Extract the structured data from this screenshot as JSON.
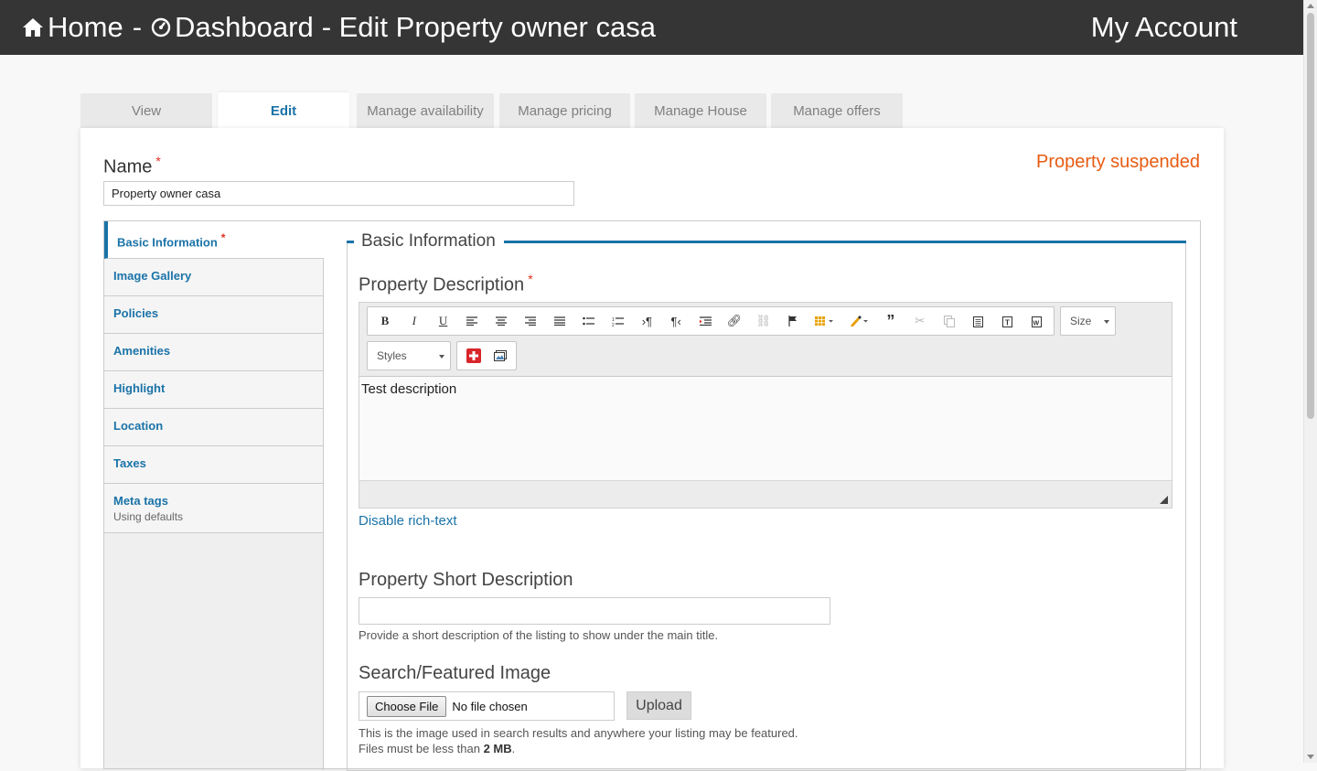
{
  "header": {
    "home_label": "Home",
    "separator": "-",
    "dashboard_label": "Dashboard",
    "page_label": "- Edit Property owner casa",
    "account_label": "My Account"
  },
  "tabs": [
    {
      "label": "View"
    },
    {
      "label": "Edit"
    },
    {
      "label": "Manage availability"
    },
    {
      "label": "Manage pricing"
    },
    {
      "label": "Manage House"
    },
    {
      "label": "Manage offers"
    }
  ],
  "form": {
    "name_label": "Name",
    "required_mark": "*",
    "name_value": "Property owner casa",
    "status": "Property suspended"
  },
  "vertical_tabs": [
    {
      "label": "Basic Information",
      "required": "*"
    },
    {
      "label": "Image Gallery"
    },
    {
      "label": "Policies"
    },
    {
      "label": "Amenities"
    },
    {
      "label": "Highlight"
    },
    {
      "label": "Location"
    },
    {
      "label": "Taxes"
    },
    {
      "label": "Meta tags",
      "sub": "Using defaults"
    }
  ],
  "basic_info": {
    "legend": "Basic Information",
    "description_label": "Property Description",
    "description_value": "Test description",
    "size_combo": "Size",
    "styles_combo": "Styles",
    "disable_rich_text": "Disable rich-text",
    "short_desc_label": "Property Short Description",
    "short_desc_value": "",
    "short_desc_help": "Provide a short description of the listing to show under the main title.",
    "image_label": "Search/Featured Image",
    "choose_file": "Choose File",
    "no_file": "No file chosen",
    "upload": "Upload",
    "image_help_1": "This is the image used in search results and anywhere your listing may be featured.",
    "image_help_2_prefix": "Files must be less than ",
    "image_help_2_bold": "2 MB",
    "image_help_2_suffix": "."
  },
  "colors": {
    "header_bg": "#353535",
    "accent": "#1a73a8",
    "status": "#e85b12",
    "required": "#e0301e"
  }
}
